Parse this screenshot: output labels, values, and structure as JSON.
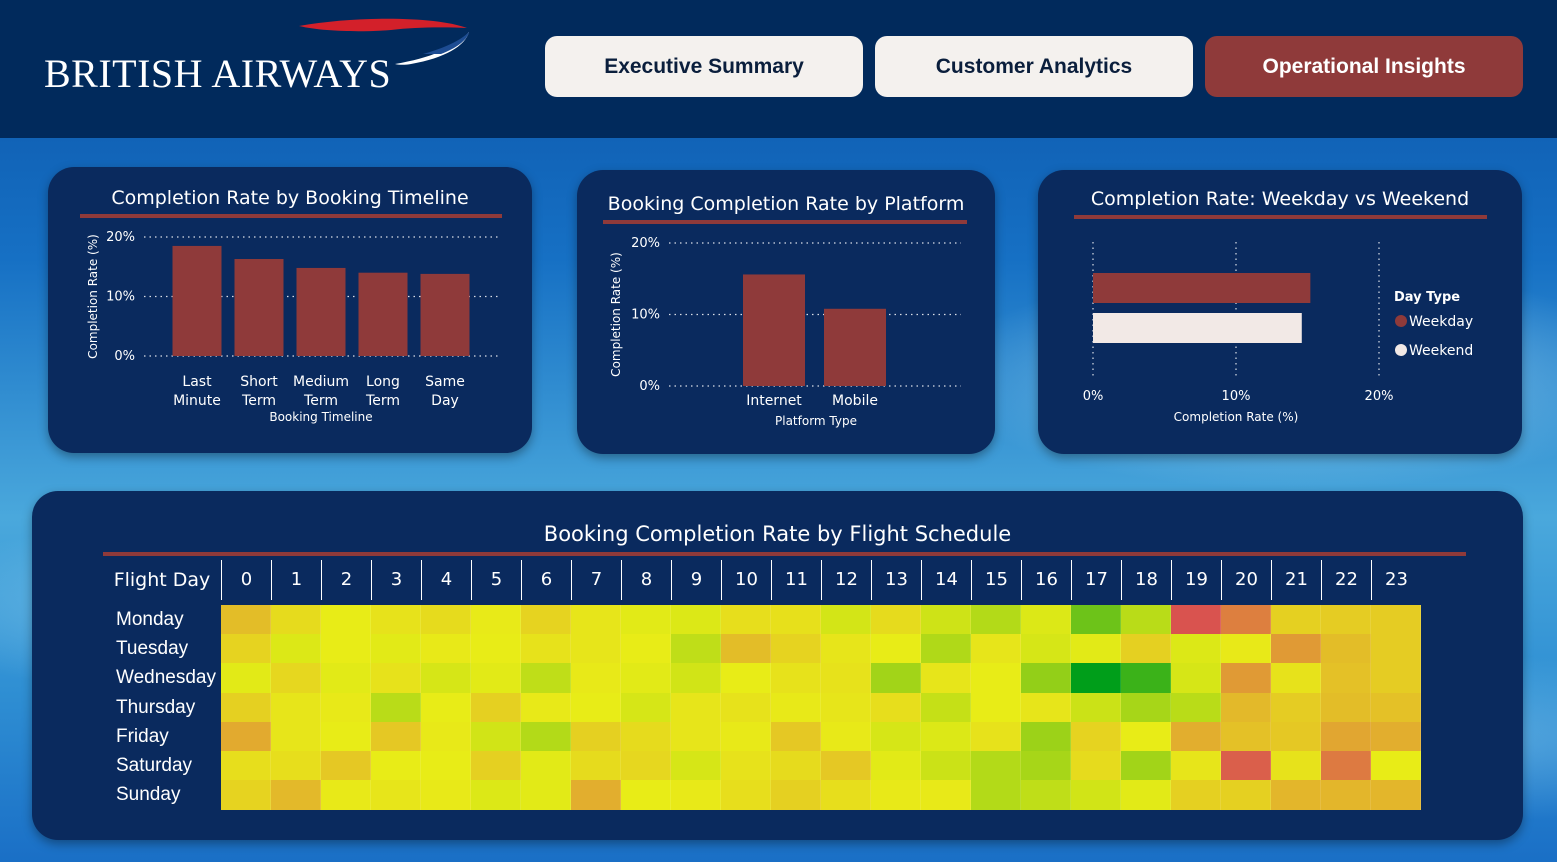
{
  "header": {
    "logo_text": "BRITISH AIRWAYS",
    "nav": [
      {
        "label": "Executive Summary",
        "active": false
      },
      {
        "label": "Customer Analytics",
        "active": false
      },
      {
        "label": "Operational Insights",
        "active": true
      }
    ]
  },
  "colors": {
    "header_bg": "#012a5c",
    "card_bg": "#0a2a5e",
    "accent": "#8f3a3a",
    "weekend": "#f2e9e6"
  },
  "booking_timeline_chart": {
    "title": "Completion Rate by Booking Timeline",
    "chart_data": {
      "type": "bar",
      "categories": [
        [
          "Last",
          "Minute"
        ],
        [
          "Short",
          "Term"
        ],
        [
          "Medium",
          "Term"
        ],
        [
          "Long",
          "Term"
        ],
        [
          "Same",
          "Day"
        ]
      ],
      "values": [
        18.5,
        16.3,
        14.8,
        14.0,
        13.8
      ],
      "xlabel": "Booking Timeline",
      "ylabel": "Completion Rate (%)",
      "yticks": [
        "0%",
        "10%",
        "20%"
      ],
      "ylim": [
        0,
        20
      ],
      "grid": true
    }
  },
  "platform_chart": {
    "title": "Booking Completion Rate by Platform",
    "chart_data": {
      "type": "bar",
      "categories": [
        "Internet",
        "Mobile"
      ],
      "values": [
        15.6,
        10.8
      ],
      "xlabel": "Platform Type",
      "ylabel": "Completion Rate (%)",
      "yticks": [
        "0%",
        "10%",
        "20%"
      ],
      "ylim": [
        0,
        20
      ],
      "grid": true
    }
  },
  "weekday_chart": {
    "title": "Completion Rate: Weekday vs Weekend",
    "chart_data": {
      "type": "bar",
      "orientation": "horizontal",
      "series": [
        {
          "name": "Weekday",
          "value": 15.2
        },
        {
          "name": "Weekend",
          "value": 14.6
        }
      ],
      "xlabel": "Completion Rate (%)",
      "xticks": [
        "0%",
        "10%",
        "20%"
      ],
      "xlim": [
        0,
        20
      ],
      "legend_title": "Day Type",
      "legend_position": "right",
      "grid": true
    }
  },
  "heatmap": {
    "title": "Booking Completion Rate by Flight Schedule",
    "corner_label": "Flight Day",
    "chart_data": {
      "type": "heatmap",
      "hours": [
        "0",
        "1",
        "2",
        "3",
        "4",
        "5",
        "6",
        "7",
        "8",
        "9",
        "10",
        "11",
        "12",
        "13",
        "14",
        "15",
        "16",
        "17",
        "18",
        "19",
        "20",
        "21",
        "22",
        "23"
      ],
      "days": [
        "Monday",
        "Tuesday",
        "Wednesday",
        "Thursday",
        "Friday",
        "Saturday",
        "Sunday"
      ],
      "values": [
        [
          13.0,
          14.6,
          15.6,
          15.0,
          14.6,
          15.5,
          14.2,
          15.2,
          15.8,
          16.0,
          14.8,
          14.9,
          16.3,
          14.6,
          16.5,
          17.4,
          16.0,
          19.8,
          17.2,
          8.5,
          10.0,
          14.0,
          13.8,
          13.8
        ],
        [
          14.2,
          16.0,
          15.6,
          15.8,
          15.4,
          15.6,
          15.0,
          15.2,
          15.6,
          17.0,
          13.0,
          14.2,
          15.2,
          15.6,
          17.5,
          15.2,
          16.2,
          15.8,
          14.0,
          16.0,
          15.4,
          11.2,
          13.0,
          13.8
        ],
        [
          15.8,
          14.4,
          15.8,
          15.0,
          16.2,
          15.8,
          17.0,
          15.4,
          15.8,
          16.4,
          15.6,
          15.0,
          15.0,
          18.0,
          15.2,
          15.6,
          18.5,
          23.5,
          21.5,
          16.2,
          11.2,
          15.0,
          13.2,
          13.8
        ],
        [
          14.0,
          15.2,
          15.4,
          17.2,
          15.6,
          14.0,
          15.4,
          15.6,
          16.2,
          15.2,
          15.0,
          15.4,
          15.2,
          14.8,
          16.8,
          15.6,
          15.2,
          16.6,
          17.8,
          17.2,
          12.8,
          13.8,
          13.0,
          13.2
        ],
        [
          12.0,
          15.2,
          15.6,
          13.6,
          15.4,
          16.4,
          17.4,
          14.0,
          14.6,
          15.2,
          15.4,
          13.6,
          15.4,
          16.2,
          16.0,
          15.0,
          18.2,
          14.2,
          15.6,
          12.2,
          13.2,
          13.6,
          11.8,
          12.2
        ],
        [
          14.8,
          14.8,
          13.6,
          15.6,
          15.6,
          14.0,
          15.8,
          14.6,
          14.4,
          16.2,
          15.0,
          14.6,
          13.6,
          15.8,
          16.6,
          17.4,
          17.8,
          14.6,
          18.0,
          15.2,
          8.8,
          15.0,
          9.8,
          15.6
        ],
        [
          14.2,
          12.8,
          15.4,
          15.2,
          15.4,
          16.0,
          15.8,
          12.2,
          15.6,
          15.4,
          14.8,
          14.0,
          14.8,
          15.4,
          15.4,
          17.4,
          17.0,
          16.4,
          15.8,
          14.0,
          14.0,
          12.6,
          12.6,
          12.6
        ]
      ],
      "color_scale": [
        "#d9534f",
        "#e8ec17",
        "#009e1a"
      ]
    }
  }
}
